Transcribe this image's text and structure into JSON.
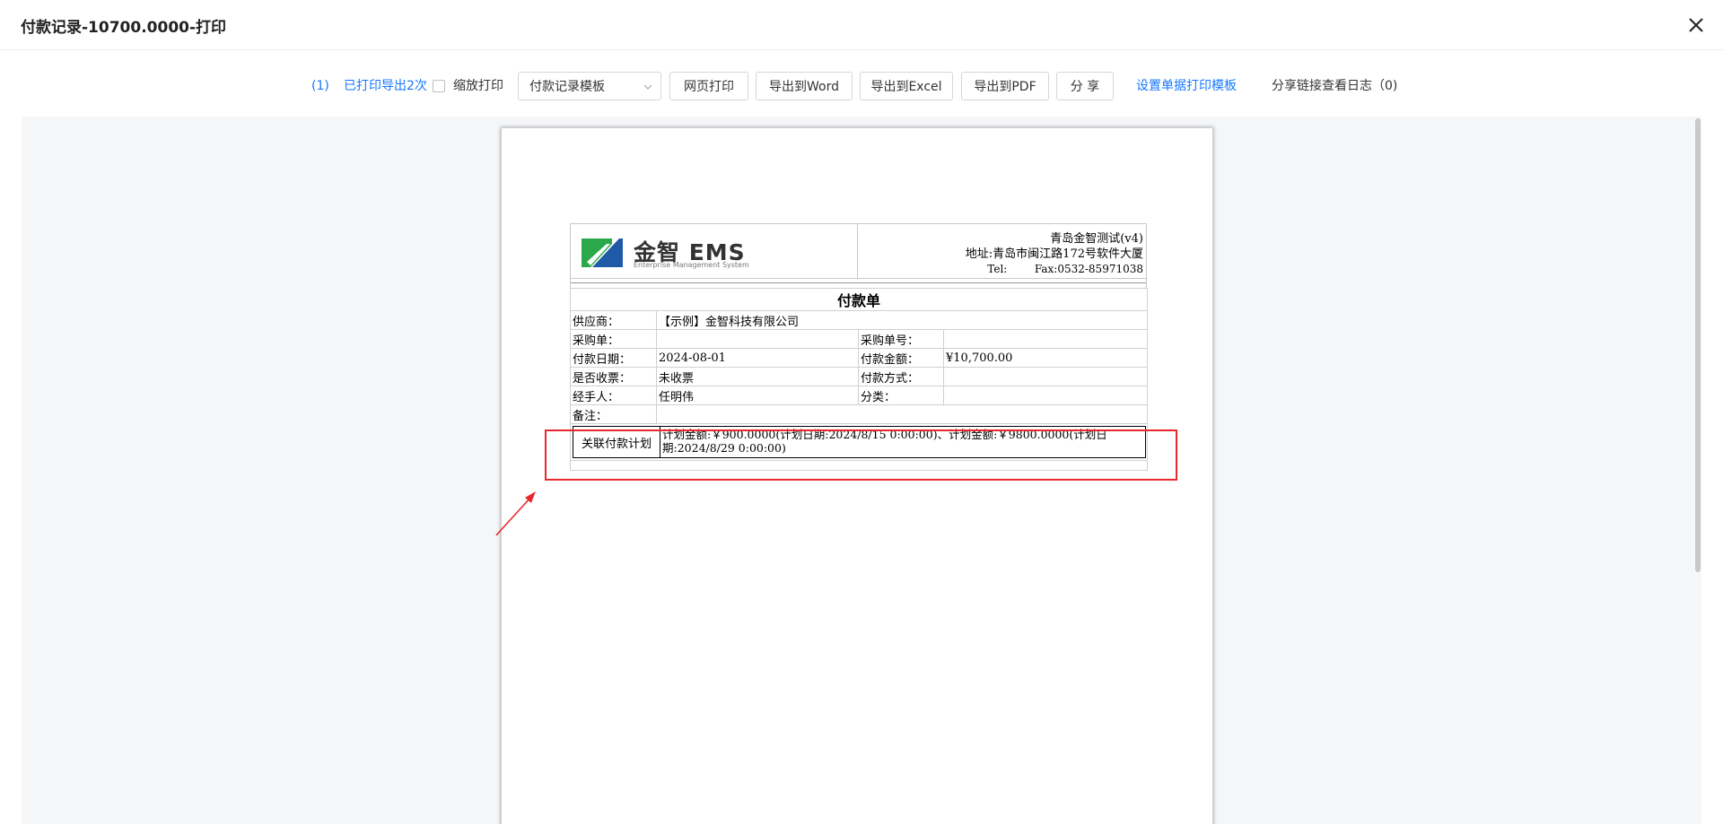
{
  "dialog": {
    "title": "付款记录-10700.0000-打印"
  },
  "toolbar": {
    "print_count": "(1)",
    "printed_info": "已打印导出2次",
    "scale_print_label": "缩放打印",
    "template_select": "付款记录模板",
    "web_print": "网页打印",
    "export_word": "导出到Word",
    "export_excel": "导出到Excel",
    "export_pdf": "导出到PDF",
    "share": "分 享",
    "set_template": "设置单据打印模板",
    "share_log": "分享链接查看日志（0)"
  },
  "document": {
    "logo_text": "金智 EMS",
    "logo_subtitle": "Enterprise Management System",
    "company_name": "青岛金智测试(v4)",
    "company_address": "地址:青岛市闽江路172号软件大厦",
    "company_tel": "Tel:        Fax:0532-85971038",
    "form_title": "付款单",
    "supplier_label": "供应商：",
    "supplier_value": "【示例】金智科技有限公司",
    "purchase_order_label": "采购单：",
    "purchase_order_value": "",
    "purchase_no_label": "采购单号：",
    "purchase_no_value": "",
    "pay_date_label": "付款日期：",
    "pay_date_value": "2024-08-01",
    "pay_amount_label": "付款金额：",
    "pay_amount_value": "¥10,700.00",
    "invoice_label": "是否收票：",
    "invoice_value": "未收票",
    "pay_method_label": "付款方式：",
    "pay_method_value": "",
    "handler_label": "经手人：",
    "handler_value": "任明伟",
    "category_label": "分类：",
    "category_value": "",
    "remark_label": "备注：",
    "remark_value": "",
    "plan_label": "关联付款计划",
    "plan_value": "计划金额:￥900.0000(计划日期:2024/8/15 0:00:00)、计划金额:￥9800.0000(计划日期:2024/8/29 0:00:00)"
  },
  "colors": {
    "link": "#1677ff",
    "annotation": "#e8282d",
    "logo_green": "#2aa84a",
    "logo_blue": "#1f5aa6"
  },
  "icons": {
    "close": "close-icon",
    "chevron": "chevron-down-icon",
    "arrow": "annotation-arrow"
  }
}
